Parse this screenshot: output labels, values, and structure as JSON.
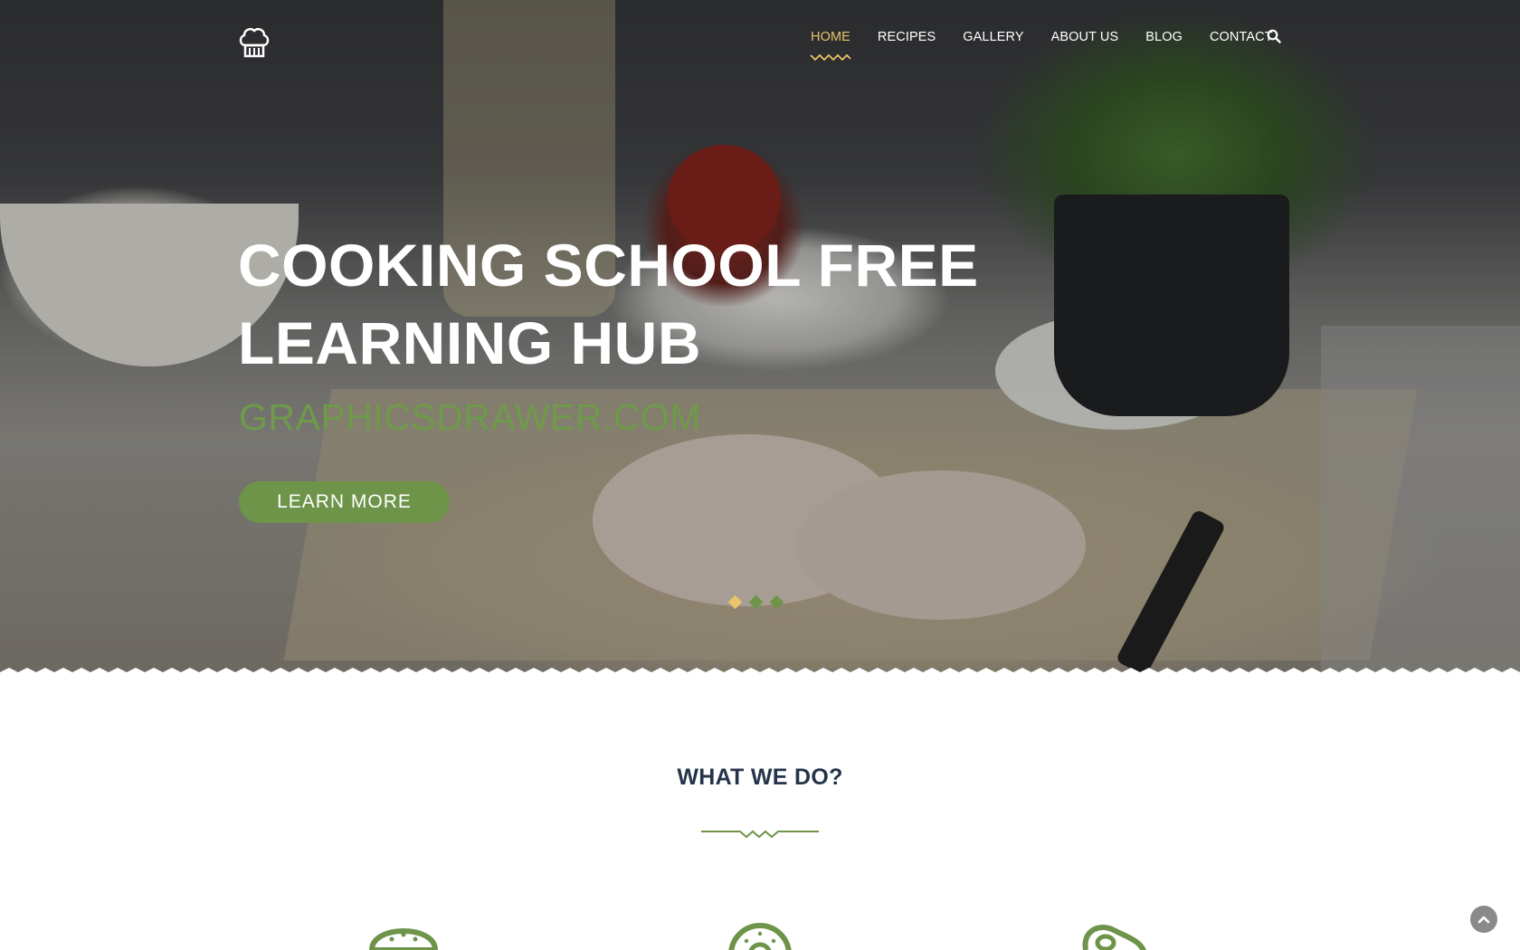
{
  "header": {
    "logo_icon": "chef-hat-icon",
    "nav": [
      {
        "label": "HOME",
        "active": true
      },
      {
        "label": "RECIPES",
        "active": false
      },
      {
        "label": "GALLERY",
        "active": false
      },
      {
        "label": "ABOUT US",
        "active": false
      },
      {
        "label": "BLOG",
        "active": false
      },
      {
        "label": "CONTACT",
        "active": false
      }
    ],
    "search_icon": "search-icon"
  },
  "hero": {
    "title_line1": "COOKING SCHOOL FREE",
    "title_line2": "LEARNING HUB",
    "subtitle": "GRAPHICSDRAWER.COM",
    "button_label": "LEARN MORE",
    "slides": {
      "count": 3,
      "active_index": 0
    }
  },
  "section": {
    "title": "WHAT WE DO?",
    "features": [
      {
        "icon": "burger-icon"
      },
      {
        "icon": "donut-icon"
      },
      {
        "icon": "avocado-icon"
      }
    ]
  },
  "back_to_top_icon": "chevron-up-icon",
  "colors": {
    "accent_green": "#6e944a",
    "accent_gold": "#e8c46a",
    "heading_navy": "#25344a",
    "white": "#ffffff"
  }
}
